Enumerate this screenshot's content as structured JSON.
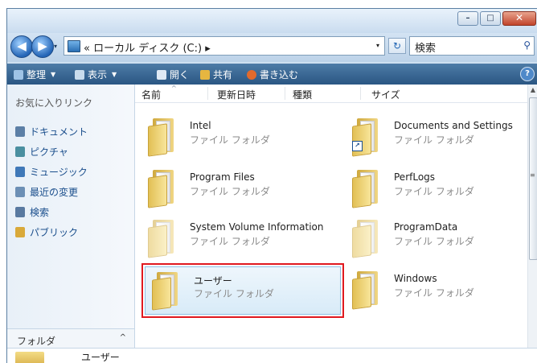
{
  "window": {
    "caption": {
      "minimize": "–",
      "maximize": "□",
      "close": "✕"
    }
  },
  "address": {
    "back_glyph": "◀",
    "forward_glyph": "▶",
    "path_prefix": "«",
    "path_text": "ローカル ディスク (C:)",
    "path_arrow": "▸",
    "dropdown": "▾",
    "refresh_glyph": "↻",
    "search_placeholder": "検索",
    "search_icon": "⚲"
  },
  "toolbar": {
    "organize": "整理",
    "views": "表示",
    "open": "開く",
    "share": "共有",
    "burn": "書き込む",
    "help": "?"
  },
  "navpane": {
    "favorites_title": "お気に入りリンク",
    "items": [
      {
        "label": "ドキュメント",
        "icon": "documents-icon",
        "color": "#5c7fa6"
      },
      {
        "label": "ピクチャ",
        "icon": "pictures-icon",
        "color": "#4a8fa0"
      },
      {
        "label": "ミュージック",
        "icon": "music-icon",
        "color": "#3f78b8"
      },
      {
        "label": "最近の変更",
        "icon": "recent-changes-icon",
        "color": "#6c8fb5"
      },
      {
        "label": "検索",
        "icon": "search-icon",
        "color": "#5979a0"
      },
      {
        "label": "パブリック",
        "icon": "public-icon",
        "color": "#d9a93a"
      }
    ],
    "folders_label": "フォルダ",
    "folders_chevron": "^"
  },
  "columns": {
    "name": "名前",
    "modified": "更新日時",
    "type": "種類",
    "size": "サイズ"
  },
  "items": [
    {
      "name": "Intel",
      "type": "ファイル フォルダ",
      "selected": false
    },
    {
      "name": "Documents and Settings",
      "type": "ファイル フォルダ",
      "shortcut": true,
      "selected": false
    },
    {
      "name": "Program Files",
      "type": "ファイル フォルダ",
      "selected": false
    },
    {
      "name": "PerfLogs",
      "type": "ファイル フォルダ",
      "selected": false
    },
    {
      "name": "System Volume Information",
      "type": "ファイル フォルダ",
      "selected": false
    },
    {
      "name": "ProgramData",
      "type": "ファイル フォルダ",
      "selected": false
    },
    {
      "name": "ユーザー",
      "type": "ファイル フォルダ",
      "selected": true
    },
    {
      "name": "Windows",
      "type": "ファイル フォルダ",
      "selected": false
    }
  ],
  "statusbar": {
    "text": "ユーザー"
  },
  "colors": {
    "selection_outline": "#e0191f",
    "toolbar": "#2a5683",
    "link": "#1a4e8c"
  }
}
